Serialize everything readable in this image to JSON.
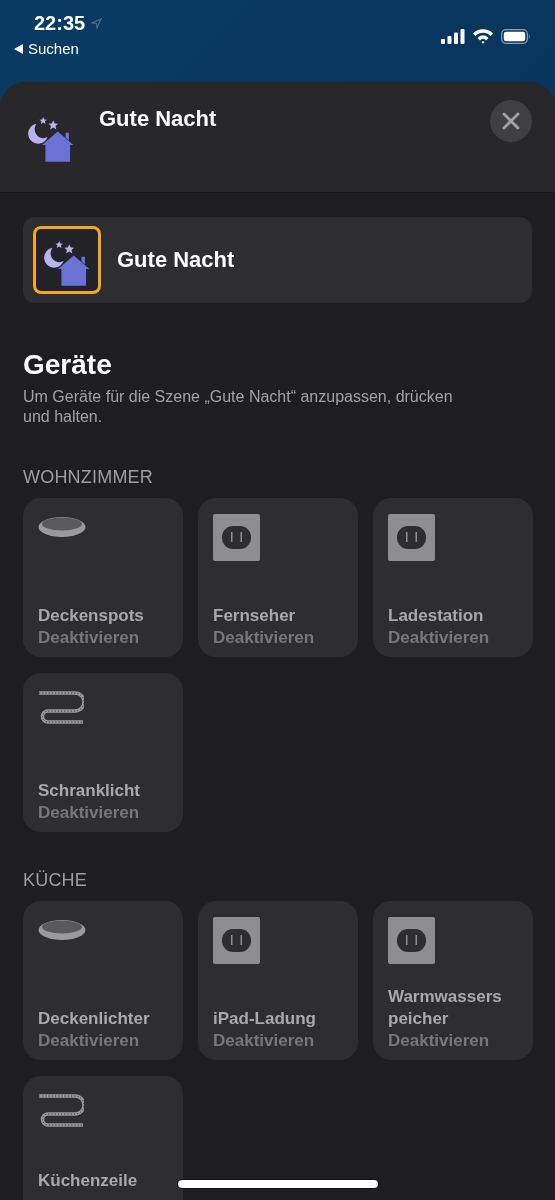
{
  "status_bar": {
    "time": "22:35",
    "back_label": "Suchen"
  },
  "header": {
    "title": "Gute Nacht"
  },
  "scene": {
    "name": "Gute Nacht",
    "selected": true
  },
  "devices": {
    "title": "Geräte",
    "hint": "Um Geräte für die Szene „Gute Nacht“ anzupassen, drücken und halten.",
    "sections": [
      {
        "title": "WOHNZIMMER",
        "tiles": [
          {
            "kind": "downlight",
            "name": "Deckenspots",
            "status": "Deaktivieren"
          },
          {
            "kind": "outlet",
            "name": "Fernseher",
            "status": "Deaktivieren"
          },
          {
            "kind": "outlet",
            "name": "Ladestation",
            "status": "Deaktivieren"
          },
          {
            "kind": "strip",
            "name": "Schranklicht",
            "status": "Deaktivieren"
          }
        ]
      },
      {
        "title": "KÜCHE",
        "tiles": [
          {
            "kind": "downlight",
            "name": "Deckenlichter",
            "status": "Deaktivieren"
          },
          {
            "kind": "outlet",
            "name": "iPad-Ladung",
            "status": "Deaktivieren"
          },
          {
            "kind": "outlet",
            "name": "Warmwassers peicher",
            "status": "Deaktivieren"
          },
          {
            "kind": "strip",
            "name": "Küchenzeile"
          }
        ]
      }
    ]
  }
}
